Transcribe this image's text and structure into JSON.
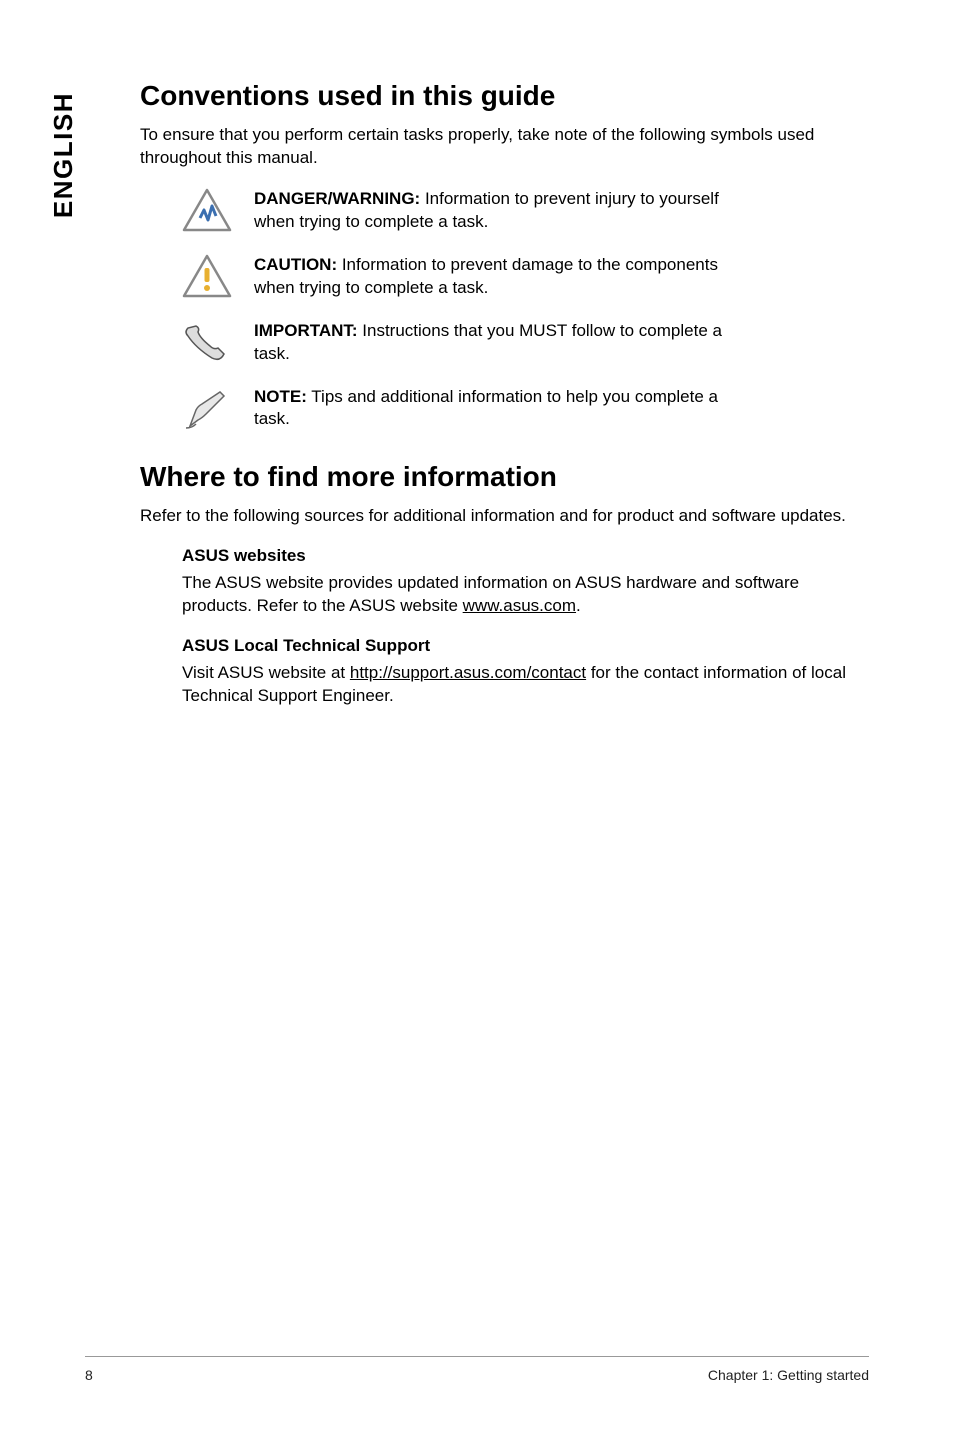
{
  "sideTab": "ENGLISH",
  "section1": {
    "heading": "Conventions used in this guide",
    "intro": "To ensure that you perform certain tasks properly, take note of the following symbols used throughout this manual.",
    "notices": [
      {
        "label": "DANGER/WARNING:",
        "body": " Information to prevent injury to yourself when trying to complete a task.",
        "icon": "danger"
      },
      {
        "label": "CAUTION:",
        "body": " Information to prevent damage to the components when trying to complete a task.",
        "icon": "caution"
      },
      {
        "label": "IMPORTANT:",
        "body": " Instructions that you MUST follow to complete a task.",
        "icon": "important"
      },
      {
        "label": "NOTE:",
        "body": " Tips and additional information to help you complete a task.",
        "icon": "note"
      }
    ]
  },
  "section2": {
    "heading": "Where to find more information",
    "intro": "Refer to the following sources for additional information and for product and software updates.",
    "items": [
      {
        "title": "ASUS websites",
        "body_pre": "The ASUS website provides updated information on ASUS hardware and software products. Refer to the ASUS website ",
        "link": "www.asus.com",
        "body_post": "."
      },
      {
        "title": "ASUS Local Technical Support",
        "body_pre": "Visit ASUS website at ",
        "link": "http://support.asus.com/contact",
        "body_post": " for the contact information of local Technical Support Engineer."
      }
    ]
  },
  "footer": {
    "pageNum": "8",
    "chapter": "Chapter 1: Getting started"
  }
}
